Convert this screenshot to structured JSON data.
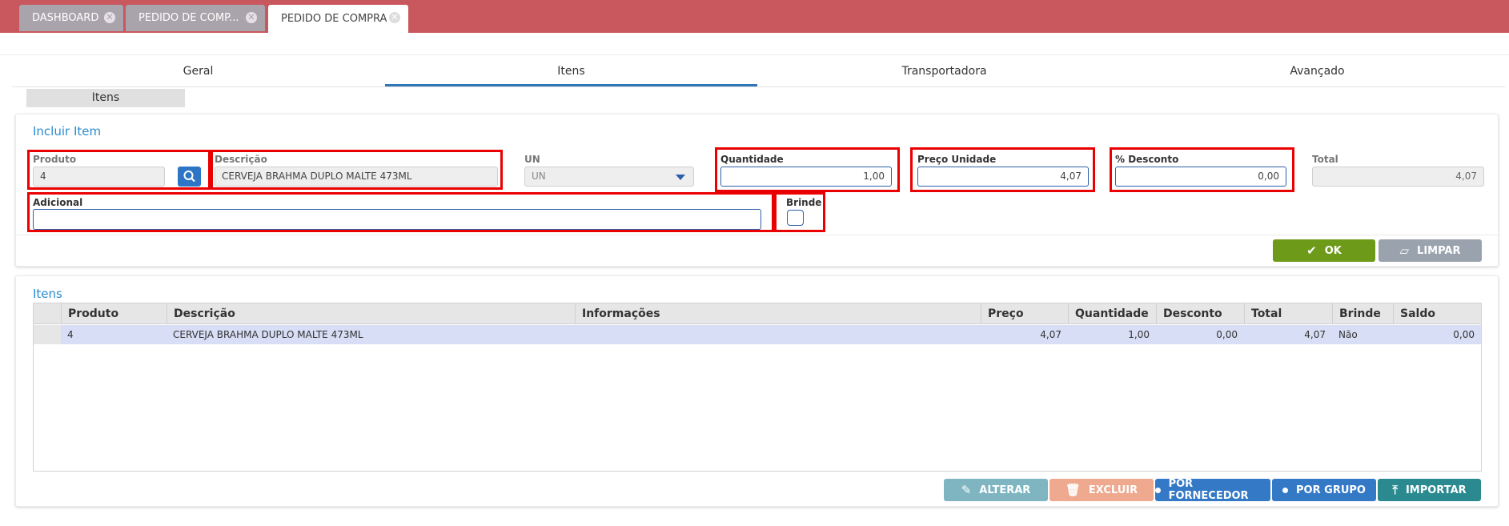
{
  "top_tabs": [
    {
      "label": "DASHBOARD"
    },
    {
      "label": "PEDIDO DE COMP..."
    },
    {
      "label": "PEDIDO DE COMPRA"
    }
  ],
  "section_tabs": [
    "Geral",
    "Itens",
    "Transportadora",
    "Avançado"
  ],
  "subtab": "Itens",
  "form": {
    "title": "Incluir Item",
    "produto_label": "Produto",
    "produto_value": "4",
    "descricao_label": "Descrição",
    "descricao_value": "CERVEJA BRAHMA DUPLO MALTE 473ML",
    "un_label": "UN",
    "un_value": "UN",
    "quantidade_label": "Quantidade",
    "quantidade_value": "1,00",
    "preco_label": "Preço Unidade",
    "preco_value": "4,07",
    "desconto_label": "% Desconto",
    "desconto_value": "0,00",
    "total_label": "Total",
    "total_value": "4,07",
    "adicional_label": "Adicional",
    "adicional_value": "",
    "brinde_label": "Brinde",
    "ok_label": "OK",
    "limpar_label": "LIMPAR"
  },
  "itens": {
    "title": "Itens",
    "columns": [
      "Produto",
      "Descrição",
      "Informações",
      "Preço",
      "Quantidade",
      "Desconto",
      "Total",
      "Brinde",
      "Saldo"
    ],
    "rows": [
      {
        "produto": "4",
        "descricao": "CERVEJA BRAHMA DUPLO MALTE 473ML",
        "informacoes": "",
        "preco": "4,07",
        "quantidade": "1,00",
        "desconto": "0,00",
        "total": "4,07",
        "brinde": "Não",
        "saldo": "0,00"
      }
    ],
    "buttons": {
      "alterar": "ALTERAR",
      "excluir": "EXCLUIR",
      "por_fornecedor": "POR FORNECEDOR",
      "por_grupo": "POR GRUPO",
      "importar": "IMPORTAR"
    }
  },
  "colors": {
    "topbar": "#c9585e",
    "accent_blue": "#2a8ccf",
    "highlight_red": "#ea0000",
    "ok_green": "#6e9a1a",
    "row_selected": "#d8def5"
  }
}
